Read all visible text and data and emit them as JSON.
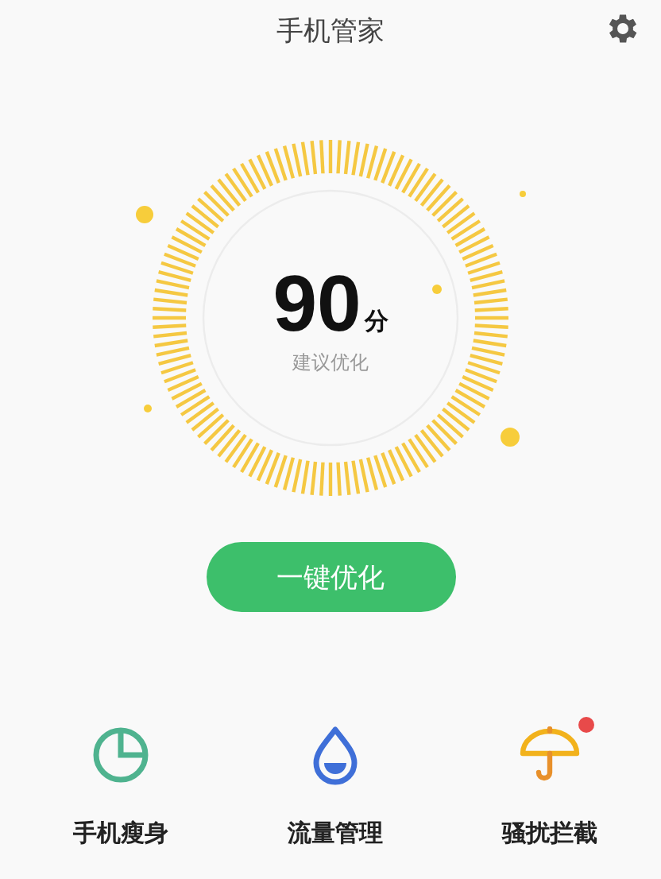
{
  "header": {
    "title": "手机管家"
  },
  "score": {
    "value": "90",
    "unit": "分",
    "hint": "建议优化"
  },
  "action_button": "一键优化",
  "tools": [
    {
      "kind": "pie",
      "label": "手机瘦身",
      "badge": false
    },
    {
      "kind": "drop",
      "label": "流量管理",
      "badge": false
    },
    {
      "kind": "umbrella",
      "label": "骚扰拦截",
      "badge": true
    }
  ]
}
